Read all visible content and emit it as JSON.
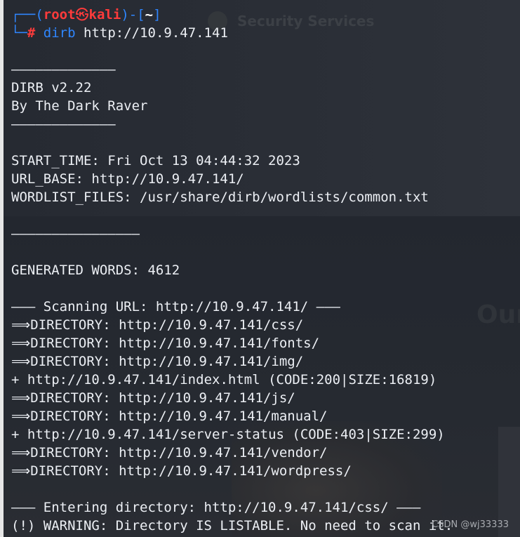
{
  "background": {
    "brand_text": "Security Services",
    "heading_text": "Our"
  },
  "prompt": {
    "open": "┌──(",
    "user": "root",
    "skull": "㉿",
    "host": "kali",
    "close": ")-[",
    "dir": "~",
    "end": "]",
    "corner": "└─",
    "hash": "#",
    "command": "dirb",
    "args": "http://10.9.47.141"
  },
  "output": {
    "rule_short": "—————————————",
    "banner_title": "DIRB v2.22",
    "banner_author": "By The Dark Raver",
    "start_time": "START_TIME: Fri Oct 13 04:44:32 2023",
    "url_base": "URL_BASE: http://10.9.47.141/",
    "wordlist": "WORDLIST_FILES: /usr/share/dirb/wordlists/common.txt",
    "rule_split": "————————————————",
    "generated": "GENERATED WORDS: 4612",
    "scanning": "——— Scanning URL: http://10.9.47.141/ ———",
    "results": [
      {
        "prefix": "⟹",
        "text": "DIRECTORY: http://10.9.47.141/css/"
      },
      {
        "prefix": "⟹",
        "text": "DIRECTORY: http://10.9.47.141/fonts/"
      },
      {
        "prefix": "⟹",
        "text": "DIRECTORY: http://10.9.47.141/img/"
      },
      {
        "prefix": "+",
        "text": "http://10.9.47.141/index.html (CODE:200|SIZE:16819)"
      },
      {
        "prefix": "⟹",
        "text": "DIRECTORY: http://10.9.47.141/js/"
      },
      {
        "prefix": "⟹",
        "text": "DIRECTORY: http://10.9.47.141/manual/"
      },
      {
        "prefix": "+",
        "text": "http://10.9.47.141/server-status (CODE:403|SIZE:299)"
      },
      {
        "prefix": "⟹",
        "text": "DIRECTORY: http://10.9.47.141/vendor/"
      },
      {
        "prefix": "⟹",
        "text": "DIRECTORY: http://10.9.47.141/wordpress/"
      }
    ],
    "entering": "——— Entering directory: http://10.9.47.141/css/ ———",
    "warning": "(!) WARNING: Directory IS LISTABLE. No need to scan it."
  },
  "watermark": "CSDN @wj33333",
  "colors": {
    "prompt_frame": "#2f86ff",
    "prompt_user": "#ff3b3b",
    "text": "#eceff4"
  }
}
